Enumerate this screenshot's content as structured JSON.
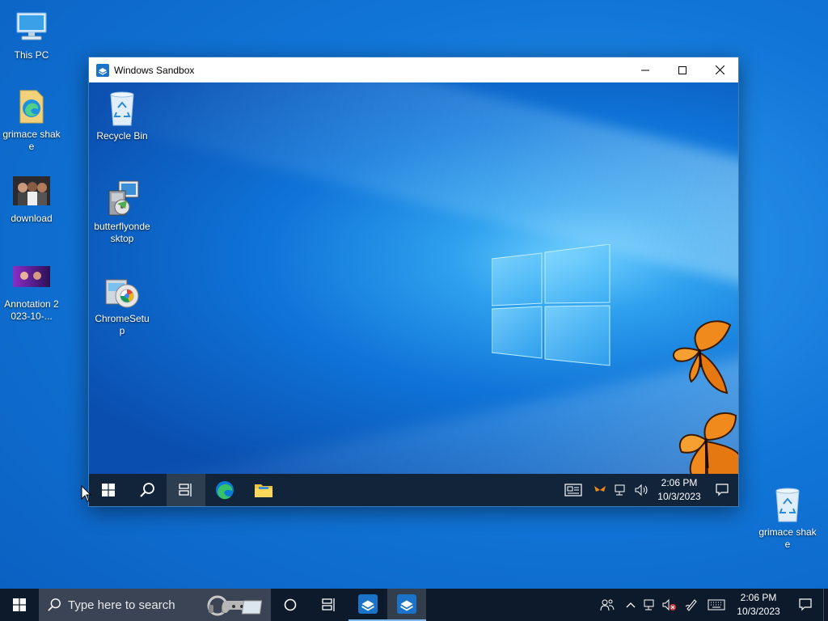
{
  "desktop": {
    "icons": [
      {
        "label": "This PC",
        "icon": "this-pc-icon"
      },
      {
        "label": "grimace shake",
        "icon": "edge-folder-icon"
      },
      {
        "label": "download",
        "icon": "photo-thumbnail-icon"
      },
      {
        "label": "Annotation 2023-10-...",
        "icon": "image-thumbnail-icon"
      },
      {
        "label": "grimace shake",
        "icon": "recycle-bin-icon"
      }
    ]
  },
  "sandbox": {
    "title": "Windows Sandbox",
    "icons": [
      {
        "label": "Recycle Bin",
        "icon": "recycle-bin-icon"
      },
      {
        "label": "butterflyondesktop",
        "icon": "installer-icon"
      },
      {
        "label": "ChromeSetup",
        "icon": "installer-icon"
      }
    ],
    "taskbar": {
      "time": "2:06 PM",
      "date": "10/3/2023"
    }
  },
  "taskbar": {
    "search_placeholder": "Type here to search",
    "time": "2:06 PM",
    "date": "10/3/2023"
  },
  "colors": {
    "desktop": "#0f74d8",
    "taskbar": "#0d1a2b",
    "accent": "#7fb7ee"
  }
}
